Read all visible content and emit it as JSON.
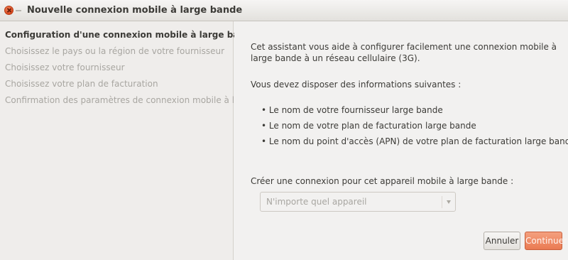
{
  "window": {
    "title": "Nouvelle connexion mobile à large bande"
  },
  "sidebar": {
    "steps": [
      {
        "label": "Configuration d'une connexion mobile à large bande",
        "active": true
      },
      {
        "label": "Choisissez le pays ou la région de votre fournisseur",
        "active": false
      },
      {
        "label": "Choisissez votre fournisseur",
        "active": false
      },
      {
        "label": "Choisissez votre plan de facturation",
        "active": false
      },
      {
        "label": "Confirmation des paramètres de connexion mobile à large bande",
        "active": false
      }
    ]
  },
  "main": {
    "intro": "Cet assistant vous aide à configurer facilement une connexion mobile à large bande à un réseau cellulaire (3G).",
    "need_heading": "Vous devez disposer des informations suivantes :",
    "requirements": [
      "• Le nom de votre fournisseur large bande",
      "• Le nom de votre plan de facturation large bande",
      "• Le nom du point d'accès (APN) de votre plan de facturation large bande (dans certains cas)"
    ],
    "device_label": "Créer une connexion pour cet appareil mobile à large bande :",
    "device_select": {
      "value": "N'importe quel appareil"
    }
  },
  "buttons": {
    "cancel": "Annuler",
    "continue": "Continuer"
  },
  "colors": {
    "accent": "#ea7a52",
    "window_bg": "#f2f1f0",
    "close_button": "#e0562b"
  },
  "icons": {
    "close": "close-icon",
    "minimize": "minimize-icon",
    "dropdown": "chevron-down-icon"
  }
}
